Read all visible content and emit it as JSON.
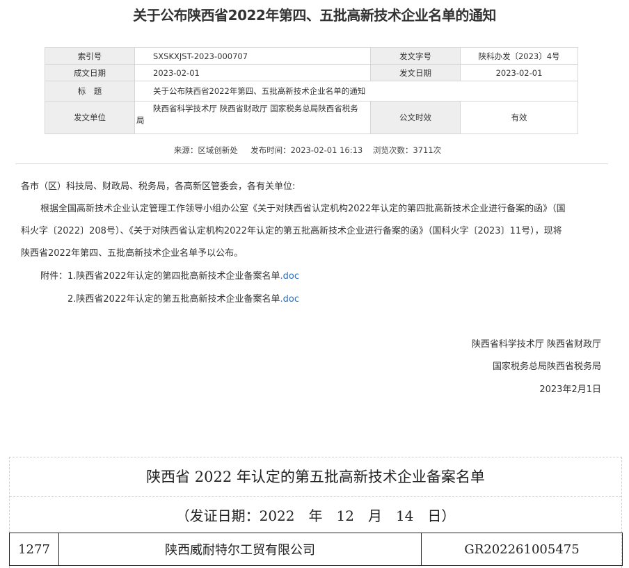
{
  "title": "关于公布陕西省2022年第四、五批高新技术企业名单的通知",
  "meta": {
    "index_label": "索引号",
    "index_value": "SXSKXJST-2023-000707",
    "doc_no_label": "发文字号",
    "doc_no_value": "陕科办发〔2023〕4号",
    "date_label": "成文日期",
    "date_value": "2023-02-01",
    "pub_date_label": "发文日期",
    "pub_date_value": "2023-02-01",
    "subject_label": "标　题",
    "subject_value": "关于公布陕西省2022年第四、五批高新技术企业名单的通知",
    "issuer_label": "发文单位",
    "issuer_value": "陕西省科学技术厅 陕西省财政厅 国家税务总局陕西省税务局",
    "validity_label": "公文时效",
    "validity_value": "有效"
  },
  "info": {
    "source": "来源：区域创新处",
    "publish_time": "发布时间：2023-02-01 16:13",
    "views": "浏览次数：3711次"
  },
  "body": {
    "salutation": "各市（区）科技局、财政局、税务局，各高新区管委会，各有关单位:",
    "para_line1": "根据全国高新技术企业认定管理工作领导小组办公室《关于对陕西省认定机构2022年认定的第四批高新技术企业进行备案的函》（国",
    "para_line2": "科火字〔2022〕208号）、《关于对陕西省认定机构2022年认定的第五批高新技术企业进行备案的函》（国科火字〔2023〕11号），现将",
    "para_line3": "陕西省2022年第四、五批高新技术企业名单予以公布。",
    "attachment_prefix": "附件：",
    "attachment1_text": "1.陕西省2022年认定的第四批高新技术企业备案名单",
    "attachment1_ext": ".doc",
    "attachment2_text": "2.陕西省2022年认定的第五批高新技术企业备案名单",
    "attachment2_ext": ".doc"
  },
  "signature": {
    "line1": "陕西省科学技术厅 陕西省财政厅",
    "line2": "国家税务总局陕西省税务局",
    "date": "2023年2月1日"
  },
  "attachment_doc": {
    "title": "陕西省 2022 年认定的第五批高新技术企业备案名单",
    "subtitle": "（发证日期：2022　年　12　月　14　日）",
    "row": {
      "no": "1277",
      "company": "陕西威耐特尔工贸有限公司",
      "cert": "GR202261005475"
    }
  }
}
